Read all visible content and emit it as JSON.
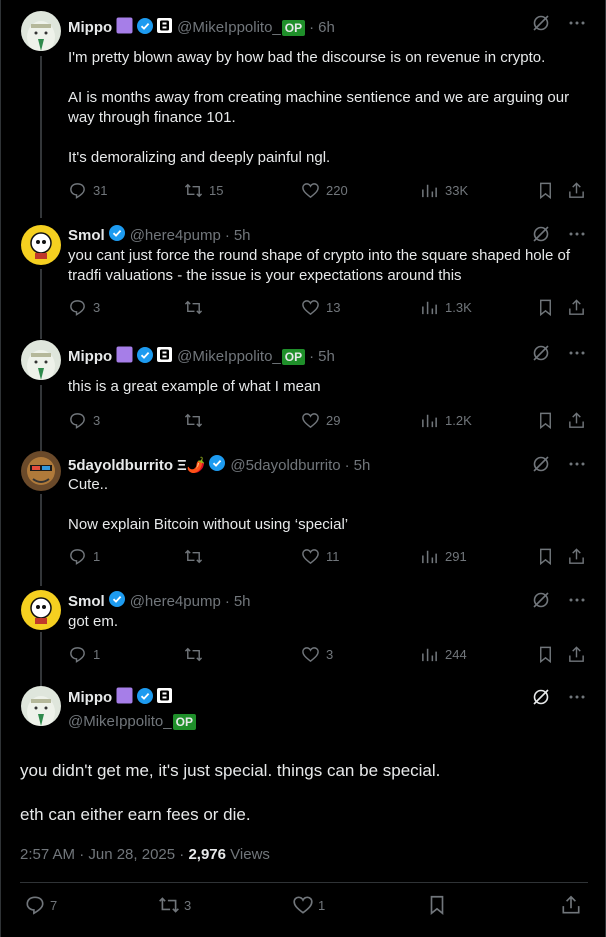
{
  "users": {
    "mippo": {
      "name": "Mippo",
      "handle": "@MikeIppolito_",
      "op": "OP"
    },
    "smol": {
      "name": "Smol",
      "handle": "@here4pump"
    },
    "burrito": {
      "name": "5dayoldburrito",
      "name_suffix": "Ξ🌶️",
      "handle": "@5dayoldburrito"
    }
  },
  "posts": [
    {
      "time": "6h",
      "paragraphs": [
        "I'm pretty blown away by how bad the discourse is on revenue in crypto.",
        "AI is months away from creating machine sentience and we are arguing our way through finance 101.",
        "It's demoralizing and deeply painful ngl."
      ],
      "replies": "31",
      "reposts": "15",
      "likes": "220",
      "views": "33K"
    },
    {
      "time": "5h",
      "paragraphs": [
        "you cant just force the round shape of crypto into the square shaped hole of tradfi valuations - the issue is your expectations around this"
      ],
      "replies": "3",
      "reposts": "",
      "likes": "13",
      "views": "1.3K"
    },
    {
      "time": "5h",
      "paragraphs": [
        "this is a great example of what I mean"
      ],
      "replies": "3",
      "reposts": "",
      "likes": "29",
      "views": "1.2K"
    },
    {
      "time": "5h",
      "paragraphs": [
        "Cute..",
        "Now explain Bitcoin without using ‘special’"
      ],
      "replies": "1",
      "reposts": "",
      "likes": "11",
      "views": "291"
    },
    {
      "time": "5h",
      "paragraphs": [
        "got em."
      ],
      "replies": "1",
      "reposts": "",
      "likes": "3",
      "views": "244"
    }
  ],
  "main_post": {
    "paragraphs": [
      "you didn't get me, it's just special. things can be special.",
      "eth can either earn fees or die."
    ],
    "timestamp": "2:57 AM · Jun 28, 2025 ·",
    "views_count": "2,976",
    "views_label": "Views",
    "replies": "7",
    "reposts": "3",
    "likes": "1"
  },
  "separator": "·",
  "colors": {
    "verified": "#1d9bf0",
    "op_badge": "#1f8f2a",
    "purple_badge": "#a67ee8",
    "muted": "#71767b"
  }
}
